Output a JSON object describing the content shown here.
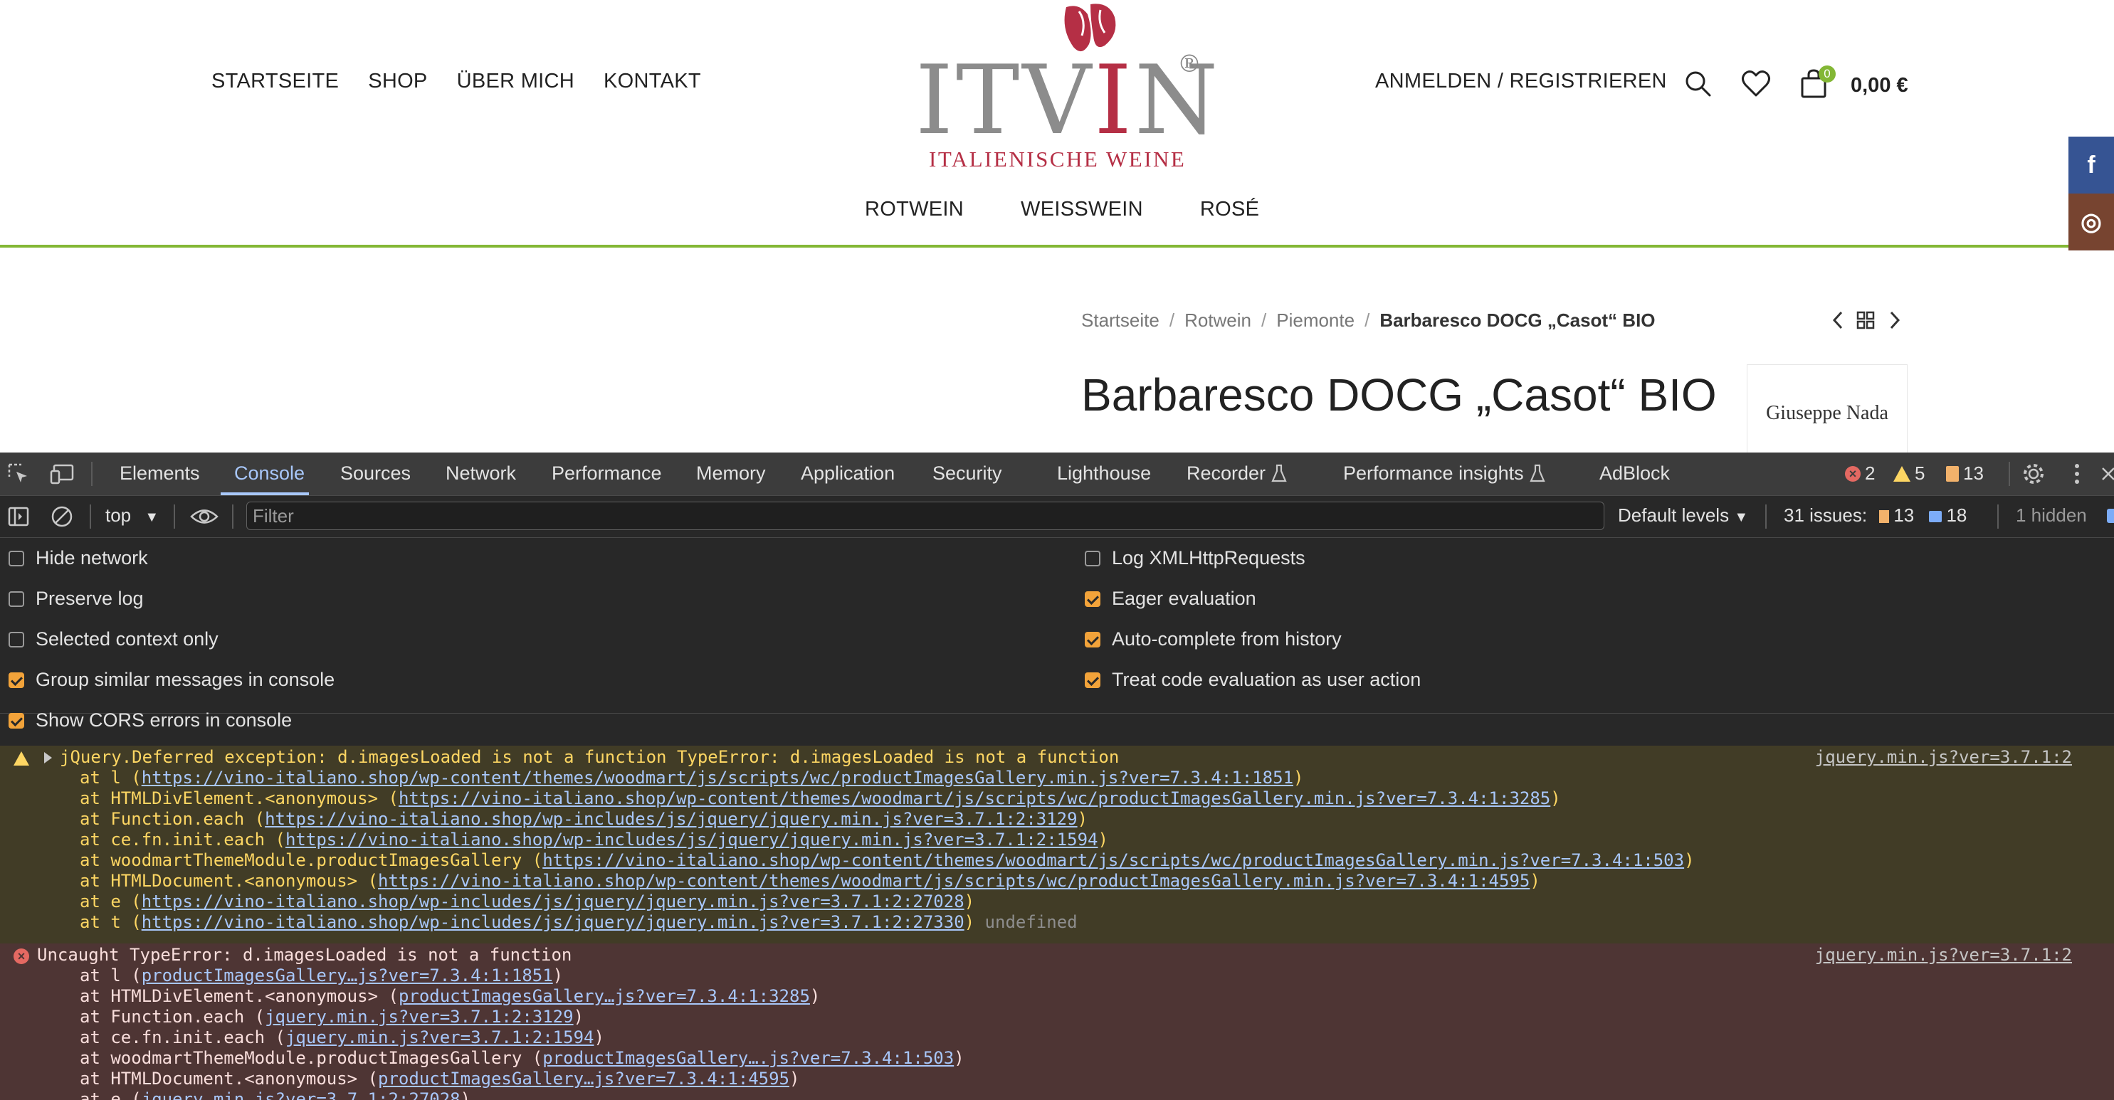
{
  "site": {
    "nav_left": [
      "STARTSEITE",
      "SHOP",
      "ÜBER MICH",
      "KONTAKT"
    ],
    "logo": {
      "part1": "ITV",
      "part2": "I",
      "part3": "N",
      "reg": "®",
      "subtitle": "ITALIENISCHE WEINE"
    },
    "nav_sub": [
      "ROTWEIN",
      "WEISSWEIN",
      "ROSÉ"
    ],
    "login": "ANMELDEN / REGISTRIEREN",
    "cart_count": "0",
    "cart_total": "0,00 €",
    "social": {
      "facebook": "f",
      "instagram": "◎"
    },
    "breadcrumb": [
      "Startseite",
      "Rotwein",
      "Piemonte",
      "Barbaresco DOCG „Casot“ BIO"
    ],
    "breadcrumb_sep": "/",
    "product_title": "Barbaresco DOCG „Casot“ BIO",
    "producer": "Giuseppe Nada",
    "colors": {
      "wine_red": "#b52f45",
      "accent_green": "#83b735"
    }
  },
  "devtools": {
    "tabs": [
      "Elements",
      "Console",
      "Sources",
      "Network",
      "Performance",
      "Memory",
      "Application",
      "Security",
      "Lighthouse",
      "Recorder",
      "Performance insights",
      "AdBlock"
    ],
    "active_tab": "Console",
    "error_count": "2",
    "warning_count": "5",
    "issue_count": "13",
    "context": "top",
    "filter_placeholder": "Filter",
    "levels": "Default levels",
    "issues_label": "31 issues:",
    "issues_warn": "13",
    "issues_info": "18",
    "hidden": "1 hidden",
    "settings_left": [
      {
        "label": "Hide network",
        "checked": false
      },
      {
        "label": "Preserve log",
        "checked": false
      },
      {
        "label": "Selected context only",
        "checked": false
      },
      {
        "label": "Group similar messages in console",
        "checked": true
      },
      {
        "label": "Show CORS errors in console",
        "checked": true
      }
    ],
    "settings_right": [
      {
        "label": "Log XMLHttpRequests",
        "checked": false
      },
      {
        "label": "Eager evaluation",
        "checked": true
      },
      {
        "label": "Auto-complete from history",
        "checked": true
      },
      {
        "label": "Treat code evaluation as user action",
        "checked": true
      }
    ],
    "warning_message": {
      "head": "jQuery.Deferred exception: d.imagesLoaded is not a function TypeError: d.imagesLoaded is not a function",
      "source": "jquery.min.js?ver=3.7.1:2",
      "trailer": "undefined",
      "stack": [
        {
          "prefix": "at l (",
          "url": "https://vino-italiano.shop/wp-content/themes/woodmart/js/scripts/wc/productImagesGallery.min.js?ver=7.3.4:1:1851",
          "suffix": ")"
        },
        {
          "prefix": "at HTMLDivElement.<anonymous> (",
          "url": "https://vino-italiano.shop/wp-content/themes/woodmart/js/scripts/wc/productImagesGallery.min.js?ver=7.3.4:1:3285",
          "suffix": ")"
        },
        {
          "prefix": "at Function.each (",
          "url": "https://vino-italiano.shop/wp-includes/js/jquery/jquery.min.js?ver=3.7.1:2:3129",
          "suffix": ")"
        },
        {
          "prefix": "at ce.fn.init.each (",
          "url": "https://vino-italiano.shop/wp-includes/js/jquery/jquery.min.js?ver=3.7.1:2:1594",
          "suffix": ")"
        },
        {
          "prefix": "at woodmartThemeModule.productImagesGallery (",
          "url": "https://vino-italiano.shop/wp-content/themes/woodmart/js/scripts/wc/productImagesGallery.min.js?ver=7.3.4:1:503",
          "suffix": ")"
        },
        {
          "prefix": "at HTMLDocument.<anonymous> (",
          "url": "https://vino-italiano.shop/wp-content/themes/woodmart/js/scripts/wc/productImagesGallery.min.js?ver=7.3.4:1:4595",
          "suffix": ")"
        },
        {
          "prefix": "at e (",
          "url": "https://vino-italiano.shop/wp-includes/js/jquery/jquery.min.js?ver=3.7.1:2:27028",
          "suffix": ")"
        },
        {
          "prefix": "at t (",
          "url": "https://vino-italiano.shop/wp-includes/js/jquery/jquery.min.js?ver=3.7.1:2:27330",
          "suffix": ")"
        }
      ]
    },
    "error_message": {
      "head": "Uncaught TypeError: d.imagesLoaded is not a function",
      "source": "jquery.min.js?ver=3.7.1:2",
      "stack": [
        {
          "prefix": "at l (",
          "url": "productImagesGallery…js?ver=7.3.4:1:1851",
          "suffix": ")"
        },
        {
          "prefix": "at HTMLDivElement.<anonymous> (",
          "url": "productImagesGallery…js?ver=7.3.4:1:3285",
          "suffix": ")"
        },
        {
          "prefix": "at Function.each (",
          "url": "jquery.min.js?ver=3.7.1:2:3129",
          "suffix": ")"
        },
        {
          "prefix": "at ce.fn.init.each (",
          "url": "jquery.min.js?ver=3.7.1:2:1594",
          "suffix": ")"
        },
        {
          "prefix": "at woodmartThemeModule.productImagesGallery (",
          "url": "productImagesGallery….js?ver=7.3.4:1:503",
          "suffix": ")"
        },
        {
          "prefix": "at HTMLDocument.<anonymous> (",
          "url": "productImagesGallery…js?ver=7.3.4:1:4595",
          "suffix": ")"
        },
        {
          "prefix": "at e (",
          "url": "jquery.min.js?ver=3.7.1:2:27028",
          "suffix": ")"
        }
      ]
    }
  }
}
